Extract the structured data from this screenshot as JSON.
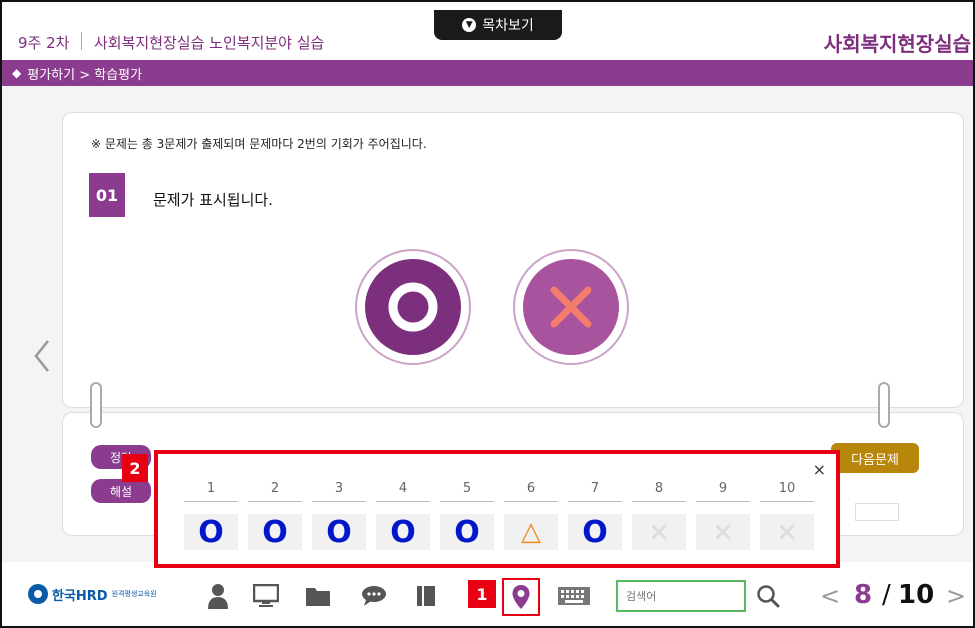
{
  "header": {
    "week": "9주 2차",
    "course_name": "사회복지현장실습 노인복지분야 실습",
    "brand_title": "사회복지현장실습",
    "toc_label": "목차보기"
  },
  "breadcrumb": {
    "text": "평가하기 > 학습평가"
  },
  "question": {
    "notice": "※ 문제는 총 3문제가 출제되며 문제마다 2번의 기회가 주어집니다.",
    "number": "01",
    "text": "문제가 표시됩니다."
  },
  "controls": {
    "answer_label": "정답",
    "explain_label": "해설",
    "next_label": "다음문제"
  },
  "progress_popup": {
    "close": "×",
    "items": [
      {
        "num": "1",
        "mark": "O",
        "status": "done"
      },
      {
        "num": "2",
        "mark": "O",
        "status": "done"
      },
      {
        "num": "3",
        "mark": "O",
        "status": "done"
      },
      {
        "num": "4",
        "mark": "O",
        "status": "done"
      },
      {
        "num": "5",
        "mark": "O",
        "status": "done"
      },
      {
        "num": "6",
        "mark": "△",
        "status": "partial"
      },
      {
        "num": "7",
        "mark": "O",
        "status": "done"
      },
      {
        "num": "8",
        "mark": "×",
        "status": "none"
      },
      {
        "num": "9",
        "mark": "×",
        "status": "none"
      },
      {
        "num": "10",
        "mark": "×",
        "status": "none"
      }
    ]
  },
  "badges": {
    "one": "1",
    "two": "2"
  },
  "footer": {
    "logo_text": "한국HRD",
    "logo_sub": "원격평생교육원",
    "search_placeholder": "검색어",
    "page_current": "8",
    "page_sep": "/",
    "page_total": "10"
  },
  "colors": {
    "brand": "#8b3c8f",
    "highlight": "#e60012",
    "done": "#0018c8",
    "partial": "#f08a1c",
    "none": "#dddddd"
  }
}
